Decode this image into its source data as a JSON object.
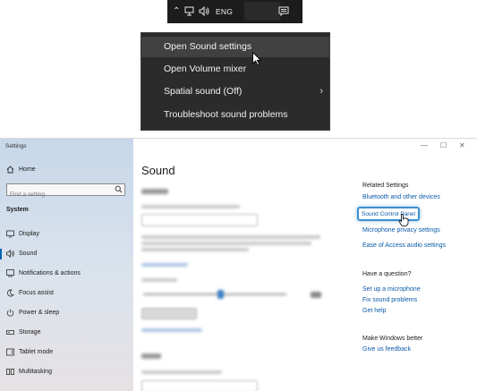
{
  "taskbar": {
    "language": "ENG",
    "icons": [
      "chevron-up-icon",
      "network-icon",
      "speaker-icon",
      "notifications-icon"
    ]
  },
  "context_menu": {
    "items": [
      {
        "label": "Open Sound settings",
        "hovered": true
      },
      {
        "label": "Open Volume mixer"
      },
      {
        "label": "Spatial sound (Off)",
        "submenu": true
      },
      {
        "label": "Troubleshoot sound problems"
      }
    ]
  },
  "settings": {
    "app_title": "Settings",
    "window_controls": [
      "—",
      "☐",
      "✕"
    ],
    "sidebar": {
      "home": "Home",
      "search_placeholder": "Find a setting",
      "section": "System",
      "items": [
        {
          "label": "Display",
          "icon": "display-icon"
        },
        {
          "label": "Sound",
          "icon": "speaker-icon",
          "active": true
        },
        {
          "label": "Notifications & actions",
          "icon": "notifications-icon"
        },
        {
          "label": "Focus assist",
          "icon": "moon-icon"
        },
        {
          "label": "Power & sleep",
          "icon": "power-icon"
        },
        {
          "label": "Storage",
          "icon": "storage-icon"
        },
        {
          "label": "Tablet mode",
          "icon": "tablet-icon"
        },
        {
          "label": "Multitasking",
          "icon": "multitasking-icon"
        }
      ]
    },
    "main": {
      "title": "Sound"
    },
    "related": {
      "heading": "Related Settings",
      "links": [
        "Bluetooth and other devices",
        "Sound Control Panel",
        "Microphone privacy settings",
        "Ease of Access audio settings"
      ],
      "question_heading": "Have a question?",
      "question_links": [
        "Set up a microphone",
        "Fix sound problems",
        "Get help"
      ],
      "better_heading": "Make Windows better",
      "better_links": [
        "Give us feedback"
      ]
    }
  }
}
